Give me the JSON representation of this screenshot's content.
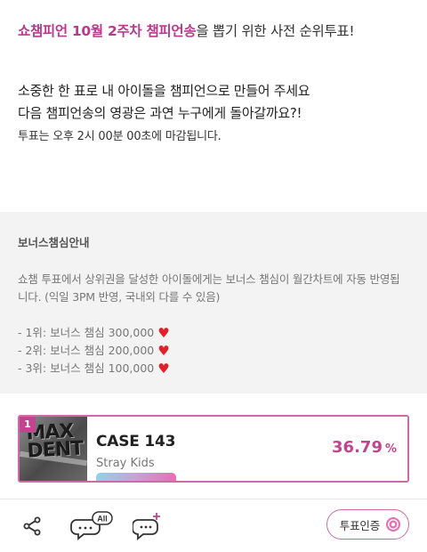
{
  "intro": {
    "headline_accent": "쇼챔피언 10월 2주차 챔피언송",
    "headline_rest": "을 뽑기 위한 사전 순위투표!",
    "desc_line1": "소중한 한 표로 내 아이돌을 챔피언으로 만들어 주세요",
    "desc_line2": "다음 챔피언송의 영광은 과연 누구에게 돌아갈까요?!",
    "deadline": "투표는 오후 2시 00분 00초에 마감됩니다."
  },
  "bonus": {
    "title": "보너스챔심안내",
    "text": "쇼챔 투표에서 상위권을 달성한 아이돌에게는 보너스 챔심이 월간차트에 자동 반영됩니다. (익일 3PM 반영, 국내외 다를 수 있음)",
    "items": [
      {
        "label": "- 1위: 보너스 챔심 300,000"
      },
      {
        "label": "- 2위: 보너스 챔심 200,000"
      },
      {
        "label": "- 3위: 보너스 챔심 100,000"
      }
    ],
    "heart_color": "#e0202a"
  },
  "ranking": {
    "rank": "1",
    "album_art_text": "MAXIDENT",
    "title": "CASE 143",
    "artist": "Stray Kids",
    "percent": "36.79",
    "percent_unit": "%",
    "vote_share": 36.79
  },
  "toolbar": {
    "share_icon": "share-icon",
    "comment_all_badge": "All",
    "comment_add_icon": "comment-add-icon",
    "verify_label": "투표인증"
  },
  "colors": {
    "accent": "#b83a8e",
    "border_accent": "#cf6aa8",
    "bonus_bg": "#f3f3f3"
  }
}
